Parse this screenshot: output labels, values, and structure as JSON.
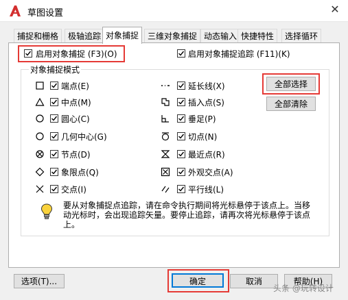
{
  "window": {
    "title": "草图设置",
    "close_glyph": "✕"
  },
  "tabs": [
    {
      "label": "捕捉和栅格"
    },
    {
      "label": "极轴追踪"
    },
    {
      "label": "对象捕捉"
    },
    {
      "label": "三维对象捕捉"
    },
    {
      "label": "动态输入"
    },
    {
      "label": "快捷特性"
    },
    {
      "label": "选择循环"
    }
  ],
  "osnap": {
    "enable_label": "启用对象捕捉 (F3)(O)",
    "enable_checked": true,
    "tracking_label": "启用对象捕捉追踪 (F11)(K)",
    "tracking_checked": true
  },
  "modes": {
    "legend": "对象捕捉模式",
    "left": [
      {
        "label": "端点(E)",
        "checked": true,
        "symbol": "square"
      },
      {
        "label": "中点(M)",
        "checked": true,
        "symbol": "triangle"
      },
      {
        "label": "圆心(C)",
        "checked": true,
        "symbol": "circle"
      },
      {
        "label": "几何中心(G)",
        "checked": true,
        "symbol": "circle"
      },
      {
        "label": "节点(D)",
        "checked": true,
        "symbol": "circle-x"
      },
      {
        "label": "象限点(Q)",
        "checked": true,
        "symbol": "diamond"
      },
      {
        "label": "交点(I)",
        "checked": true,
        "symbol": "x"
      }
    ],
    "right": [
      {
        "label": "延长线(X)",
        "checked": true,
        "symbol": "dash-dot"
      },
      {
        "label": "插入点(S)",
        "checked": true,
        "symbol": "insert"
      },
      {
        "label": "垂足(P)",
        "checked": true,
        "symbol": "perpendicular"
      },
      {
        "label": "切点(N)",
        "checked": true,
        "symbol": "tangent"
      },
      {
        "label": "最近点(R)",
        "checked": true,
        "symbol": "hourglass"
      },
      {
        "label": "外观交点(A)",
        "checked": true,
        "symbol": "square-x"
      },
      {
        "label": "平行线(L)",
        "checked": true,
        "symbol": "parallel"
      }
    ],
    "select_all": "全部选择",
    "clear_all": "全部清除"
  },
  "info": {
    "text": "要从对象捕捉点追踪，请在命令执行期间将光标悬停于该点上。当移动光标时，会出现追踪矢量。要停止追踪，请再次将光标悬停于该点上。"
  },
  "footer": {
    "options": "选项(T)...",
    "ok": "确定",
    "cancel": "取消",
    "help": "帮助(H)"
  },
  "watermark": "头条 @玩转设计",
  "colors": {
    "highlight": "#e53935",
    "accent": "#0078d7"
  }
}
